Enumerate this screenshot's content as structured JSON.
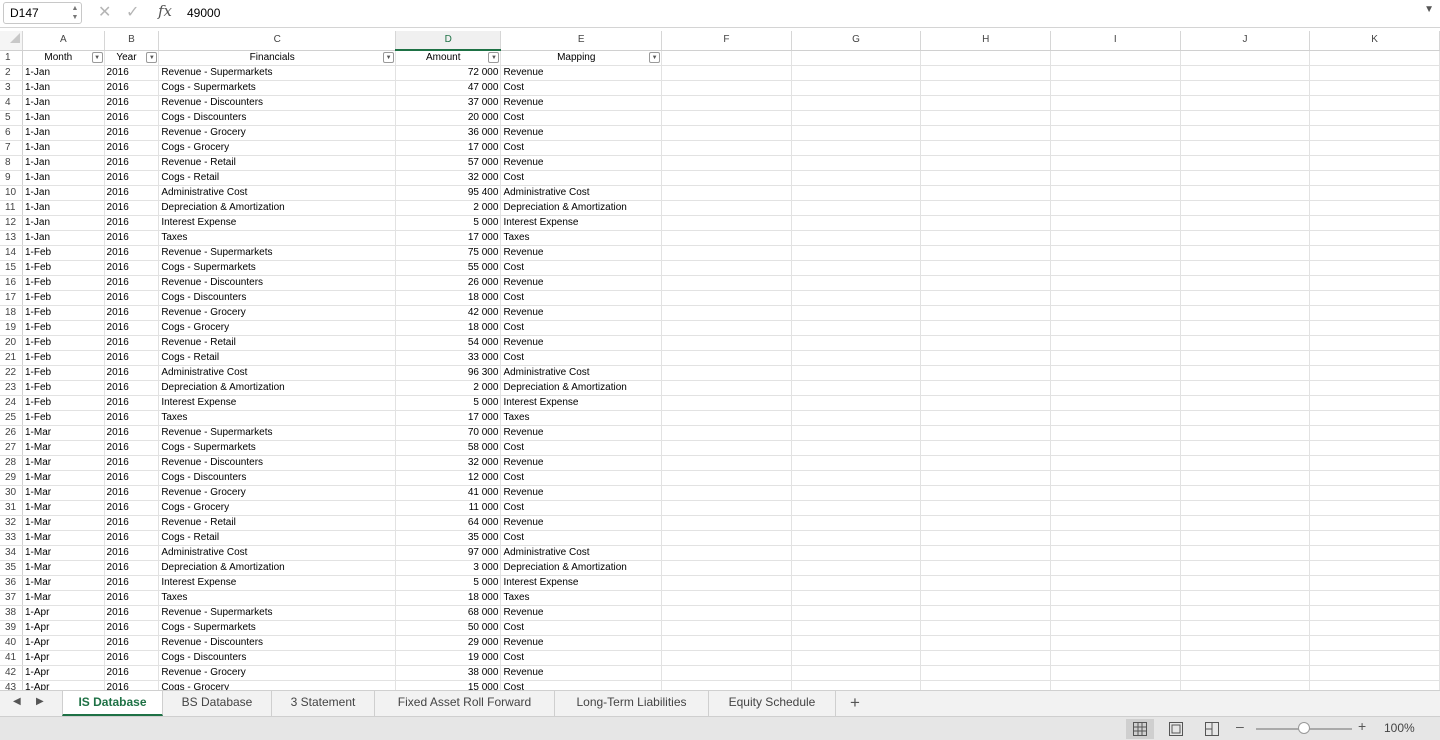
{
  "formula_bar": {
    "cell_reference": "D147",
    "fx_label": "fx",
    "formula_value": "49000"
  },
  "grid": {
    "columns": [
      "A",
      "B",
      "C",
      "D",
      "E",
      "F",
      "G",
      "H",
      "I",
      "J",
      "K"
    ],
    "selected_column": "D",
    "header_row": {
      "row_number": "1",
      "headers": [
        "Month",
        "Year",
        "Financials",
        "Amount",
        "Mapping"
      ],
      "filter_icon": "dropdown-arrow-icon"
    },
    "rows": [
      {
        "n": "2",
        "month": "1-Jan",
        "year": "2016",
        "financials": "Revenue - Supermarkets",
        "amount": "72 000",
        "mapping": "Revenue"
      },
      {
        "n": "3",
        "month": "1-Jan",
        "year": "2016",
        "financials": "Cogs - Supermarkets",
        "amount": "47 000",
        "mapping": "Cost"
      },
      {
        "n": "4",
        "month": "1-Jan",
        "year": "2016",
        "financials": "Revenue - Discounters",
        "amount": "37 000",
        "mapping": "Revenue"
      },
      {
        "n": "5",
        "month": "1-Jan",
        "year": "2016",
        "financials": "Cogs - Discounters",
        "amount": "20 000",
        "mapping": "Cost"
      },
      {
        "n": "6",
        "month": "1-Jan",
        "year": "2016",
        "financials": "Revenue - Grocery",
        "amount": "36 000",
        "mapping": "Revenue"
      },
      {
        "n": "7",
        "month": "1-Jan",
        "year": "2016",
        "financials": "Cogs - Grocery",
        "amount": "17 000",
        "mapping": "Cost"
      },
      {
        "n": "8",
        "month": "1-Jan",
        "year": "2016",
        "financials": "Revenue - Retail",
        "amount": "57 000",
        "mapping": "Revenue"
      },
      {
        "n": "9",
        "month": "1-Jan",
        "year": "2016",
        "financials": "Cogs - Retail",
        "amount": "32 000",
        "mapping": "Cost"
      },
      {
        "n": "10",
        "month": "1-Jan",
        "year": "2016",
        "financials": "Administrative Cost",
        "amount": "95 400",
        "mapping": "Administrative Cost"
      },
      {
        "n": "11",
        "month": "1-Jan",
        "year": "2016",
        "financials": "Depreciation & Amortization",
        "amount": "2 000",
        "mapping": "Depreciation & Amortization"
      },
      {
        "n": "12",
        "month": "1-Jan",
        "year": "2016",
        "financials": "Interest Expense",
        "amount": "5 000",
        "mapping": "Interest Expense"
      },
      {
        "n": "13",
        "month": "1-Jan",
        "year": "2016",
        "financials": "Taxes",
        "amount": "17 000",
        "mapping": "Taxes"
      },
      {
        "n": "14",
        "month": "1-Feb",
        "year": "2016",
        "financials": "Revenue - Supermarkets",
        "amount": "75 000",
        "mapping": "Revenue"
      },
      {
        "n": "15",
        "month": "1-Feb",
        "year": "2016",
        "financials": "Cogs - Supermarkets",
        "amount": "55 000",
        "mapping": "Cost"
      },
      {
        "n": "16",
        "month": "1-Feb",
        "year": "2016",
        "financials": "Revenue - Discounters",
        "amount": "26 000",
        "mapping": "Revenue"
      },
      {
        "n": "17",
        "month": "1-Feb",
        "year": "2016",
        "financials": "Cogs - Discounters",
        "amount": "18 000",
        "mapping": "Cost"
      },
      {
        "n": "18",
        "month": "1-Feb",
        "year": "2016",
        "financials": "Revenue - Grocery",
        "amount": "42 000",
        "mapping": "Revenue"
      },
      {
        "n": "19",
        "month": "1-Feb",
        "year": "2016",
        "financials": "Cogs - Grocery",
        "amount": "18 000",
        "mapping": "Cost"
      },
      {
        "n": "20",
        "month": "1-Feb",
        "year": "2016",
        "financials": "Revenue - Retail",
        "amount": "54 000",
        "mapping": "Revenue"
      },
      {
        "n": "21",
        "month": "1-Feb",
        "year": "2016",
        "financials": "Cogs - Retail",
        "amount": "33 000",
        "mapping": "Cost"
      },
      {
        "n": "22",
        "month": "1-Feb",
        "year": "2016",
        "financials": "Administrative Cost",
        "amount": "96 300",
        "mapping": "Administrative Cost"
      },
      {
        "n": "23",
        "month": "1-Feb",
        "year": "2016",
        "financials": "Depreciation & Amortization",
        "amount": "2 000",
        "mapping": "Depreciation & Amortization"
      },
      {
        "n": "24",
        "month": "1-Feb",
        "year": "2016",
        "financials": "Interest Expense",
        "amount": "5 000",
        "mapping": "Interest Expense"
      },
      {
        "n": "25",
        "month": "1-Feb",
        "year": "2016",
        "financials": "Taxes",
        "amount": "17 000",
        "mapping": "Taxes"
      },
      {
        "n": "26",
        "month": "1-Mar",
        "year": "2016",
        "financials": "Revenue - Supermarkets",
        "amount": "70 000",
        "mapping": "Revenue"
      },
      {
        "n": "27",
        "month": "1-Mar",
        "year": "2016",
        "financials": "Cogs - Supermarkets",
        "amount": "58 000",
        "mapping": "Cost"
      },
      {
        "n": "28",
        "month": "1-Mar",
        "year": "2016",
        "financials": "Revenue - Discounters",
        "amount": "32 000",
        "mapping": "Revenue"
      },
      {
        "n": "29",
        "month": "1-Mar",
        "year": "2016",
        "financials": "Cogs - Discounters",
        "amount": "12 000",
        "mapping": "Cost"
      },
      {
        "n": "30",
        "month": "1-Mar",
        "year": "2016",
        "financials": "Revenue - Grocery",
        "amount": "41 000",
        "mapping": "Revenue"
      },
      {
        "n": "31",
        "month": "1-Mar",
        "year": "2016",
        "financials": "Cogs - Grocery",
        "amount": "11 000",
        "mapping": "Cost"
      },
      {
        "n": "32",
        "month": "1-Mar",
        "year": "2016",
        "financials": "Revenue - Retail",
        "amount": "64 000",
        "mapping": "Revenue"
      },
      {
        "n": "33",
        "month": "1-Mar",
        "year": "2016",
        "financials": "Cogs - Retail",
        "amount": "35 000",
        "mapping": "Cost"
      },
      {
        "n": "34",
        "month": "1-Mar",
        "year": "2016",
        "financials": "Administrative Cost",
        "amount": "97 000",
        "mapping": "Administrative Cost"
      },
      {
        "n": "35",
        "month": "1-Mar",
        "year": "2016",
        "financials": "Depreciation & Amortization",
        "amount": "3 000",
        "mapping": "Depreciation & Amortization"
      },
      {
        "n": "36",
        "month": "1-Mar",
        "year": "2016",
        "financials": "Interest Expense",
        "amount": "5 000",
        "mapping": "Interest Expense"
      },
      {
        "n": "37",
        "month": "1-Mar",
        "year": "2016",
        "financials": "Taxes",
        "amount": "18 000",
        "mapping": "Taxes"
      },
      {
        "n": "38",
        "month": "1-Apr",
        "year": "2016",
        "financials": "Revenue - Supermarkets",
        "amount": "68 000",
        "mapping": "Revenue"
      },
      {
        "n": "39",
        "month": "1-Apr",
        "year": "2016",
        "financials": "Cogs - Supermarkets",
        "amount": "50 000",
        "mapping": "Cost"
      },
      {
        "n": "40",
        "month": "1-Apr",
        "year": "2016",
        "financials": "Revenue - Discounters",
        "amount": "29 000",
        "mapping": "Revenue"
      },
      {
        "n": "41",
        "month": "1-Apr",
        "year": "2016",
        "financials": "Cogs - Discounters",
        "amount": "19 000",
        "mapping": "Cost"
      },
      {
        "n": "42",
        "month": "1-Apr",
        "year": "2016",
        "financials": "Revenue - Grocery",
        "amount": "38 000",
        "mapping": "Revenue"
      },
      {
        "n": "43",
        "month": "1-Apr",
        "year": "2016",
        "financials": "Cogs - Grocery",
        "amount": "15 000",
        "mapping": "Cost"
      }
    ]
  },
  "sheet_tabs": {
    "tabs": [
      "IS Database",
      "BS Database",
      "3 Statement",
      "Fixed Asset Roll Forward",
      "Long-Term Liabilities",
      "Equity Schedule"
    ],
    "active_tab": "IS Database",
    "add_label": "+"
  },
  "status_bar": {
    "view_modes": [
      "normal-view-icon",
      "page-layout-icon",
      "page-break-preview-icon"
    ],
    "active_view": "normal-view-icon",
    "zoom_minus": "–",
    "zoom_plus": "+",
    "zoom_level": "100%",
    "zoom_fraction": 0.5
  },
  "colors": {
    "accent": "#1e7145"
  }
}
